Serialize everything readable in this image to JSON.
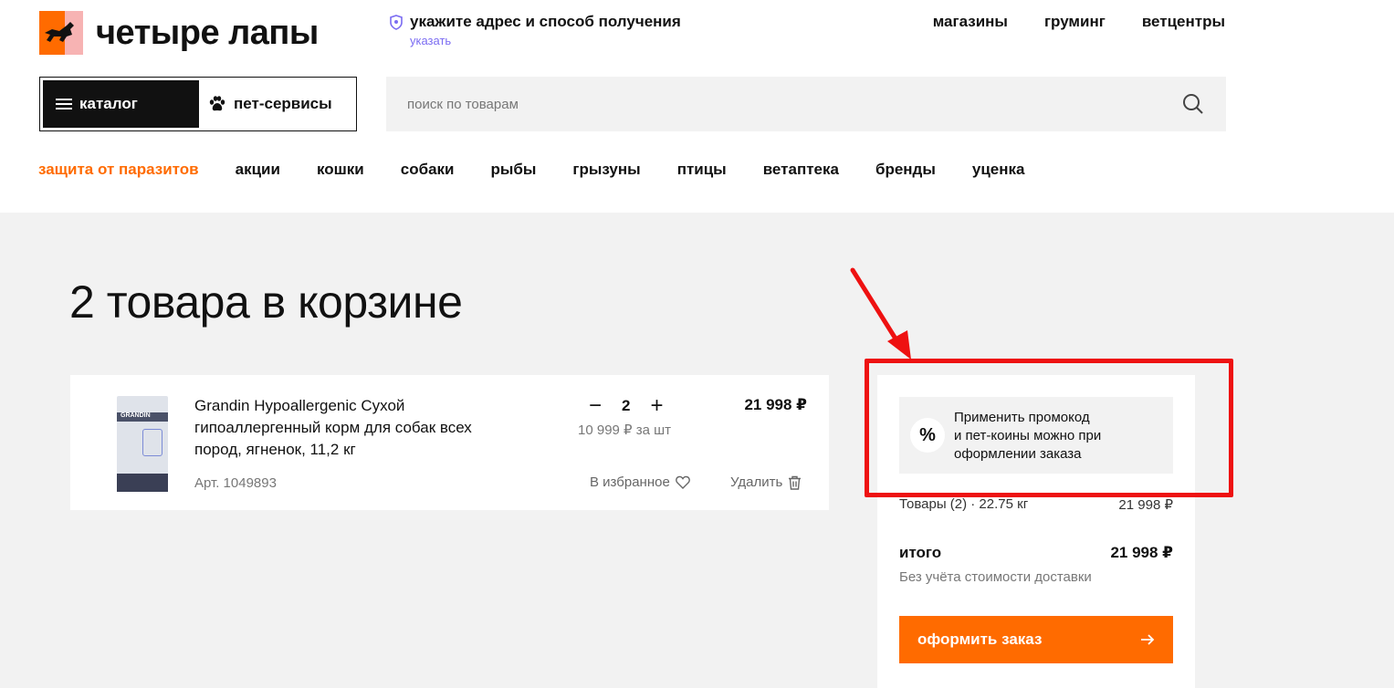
{
  "header": {
    "logo_text": "четыре лапы",
    "address_title": "укажите адрес и способ получения",
    "address_link": "указать",
    "top_nav": [
      "магазины",
      "груминг",
      "ветцентры"
    ],
    "catalog_label": "каталог",
    "pet_services_label": "пет-сервисы",
    "search_placeholder": "поиск по товарам"
  },
  "category_nav": [
    "защита от паразитов",
    "акции",
    "кошки",
    "собаки",
    "рыбы",
    "грызуны",
    "птицы",
    "ветаптека",
    "бренды",
    "уценка"
  ],
  "cart": {
    "title": "2 товара в корзине",
    "item": {
      "name": "Grandin Hypoallergenic Сухой гипоаллергенный корм для собак всех пород, ягненок, 11,2 кг",
      "article": "Арт. 1049893",
      "quantity": "2",
      "unit_price": "10 999 ₽ за шт",
      "price": "21 998 ₽",
      "favorite_label": "В избранное",
      "delete_label": "Удалить",
      "image_brand": "GRANDIN"
    }
  },
  "summary": {
    "promo_text_1": "Применить промокод",
    "promo_text_2": "и пет-коины можно при",
    "promo_text_3": "оформлении заказа",
    "promo_icon": "%",
    "goods_label": "Товары (2) · 22.75 кг",
    "goods_value": "21 998 ₽",
    "total_label": "итого",
    "total_value": "21 998 ₽",
    "delivery_note": "Без учёта стоимости доставки",
    "checkout_label": "оформить заказ"
  },
  "colors": {
    "accent": "#ff6b00",
    "highlight": "#ee1111",
    "link": "#7b6cf2"
  }
}
